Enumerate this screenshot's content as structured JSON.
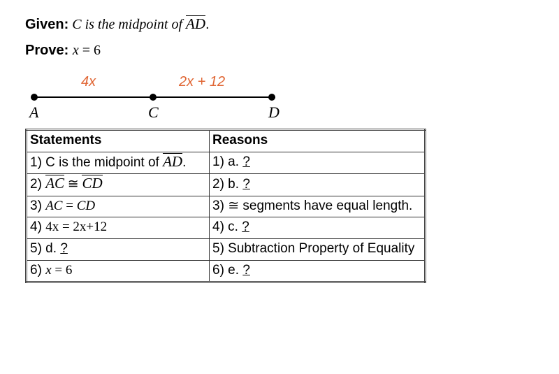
{
  "given_label": "Given:",
  "given_text_pre": " C is the midpoint of ",
  "given_seg": "AD",
  "given_text_post": ".",
  "prove_label": "Prove:",
  "prove_expr_lhs": "x",
  "prove_expr_eq": " = ",
  "prove_expr_rhs": "6",
  "diagram": {
    "label_ac": "4x",
    "label_cd": "2x + 12",
    "pt_a": "A",
    "pt_c": "C",
    "pt_d": "D"
  },
  "headers": {
    "statements": "Statements",
    "reasons": "Reasons"
  },
  "rows": [
    {
      "s_num": "1)",
      "s_pre": " C is the midpoint of ",
      "s_seg": "AD",
      "s_post": ".",
      "r_num": "1)",
      "r_text": " a. ",
      "r_blank": "?"
    },
    {
      "s_num": "2)",
      "s_seg1": "AC",
      "s_cong": " ≅ ",
      "s_seg2": "CD",
      "r_num": "2)",
      "r_text": " b. ",
      "r_blank": "?"
    },
    {
      "s_num": "3)",
      "s_expr_l": "AC",
      "s_expr_m": " = ",
      "s_expr_r": "CD",
      "r_num": "3)",
      "r_cong": "≅",
      "r_text": " segments have equal length."
    },
    {
      "s_num": "4)",
      "s_expr_l": "4x",
      "s_expr_m": " = ",
      "s_expr_r": "2x+12",
      "r_num": "4)",
      "r_text": " c. ",
      "r_blank": "?"
    },
    {
      "s_num": "5)",
      "s_text": " d. ",
      "s_blank": "?",
      "r_num": "5)",
      "r_text": " Subtraction Property of Equality"
    },
    {
      "s_num": "6)",
      "s_expr_l": "x",
      "s_expr_m": " = ",
      "s_expr_r": "6",
      "r_num": "6)",
      "r_text": " e. ",
      "r_blank": "?"
    }
  ],
  "chart_data": {
    "type": "table",
    "title": "Two-column proof",
    "columns": [
      "Statements",
      "Reasons"
    ],
    "rows": [
      [
        "1) C is the midpoint of AD.",
        "1) a. ?"
      ],
      [
        "2) AC ≅ CD",
        "2) b. ?"
      ],
      [
        "3) AC = CD",
        "3) ≅ segments have equal length."
      ],
      [
        "4) 4x = 2x+12",
        "4) c. ?"
      ],
      [
        "5) d. ?",
        "5) Subtraction Property of Equality"
      ],
      [
        "6) x = 6",
        "6) e. ?"
      ]
    ]
  }
}
